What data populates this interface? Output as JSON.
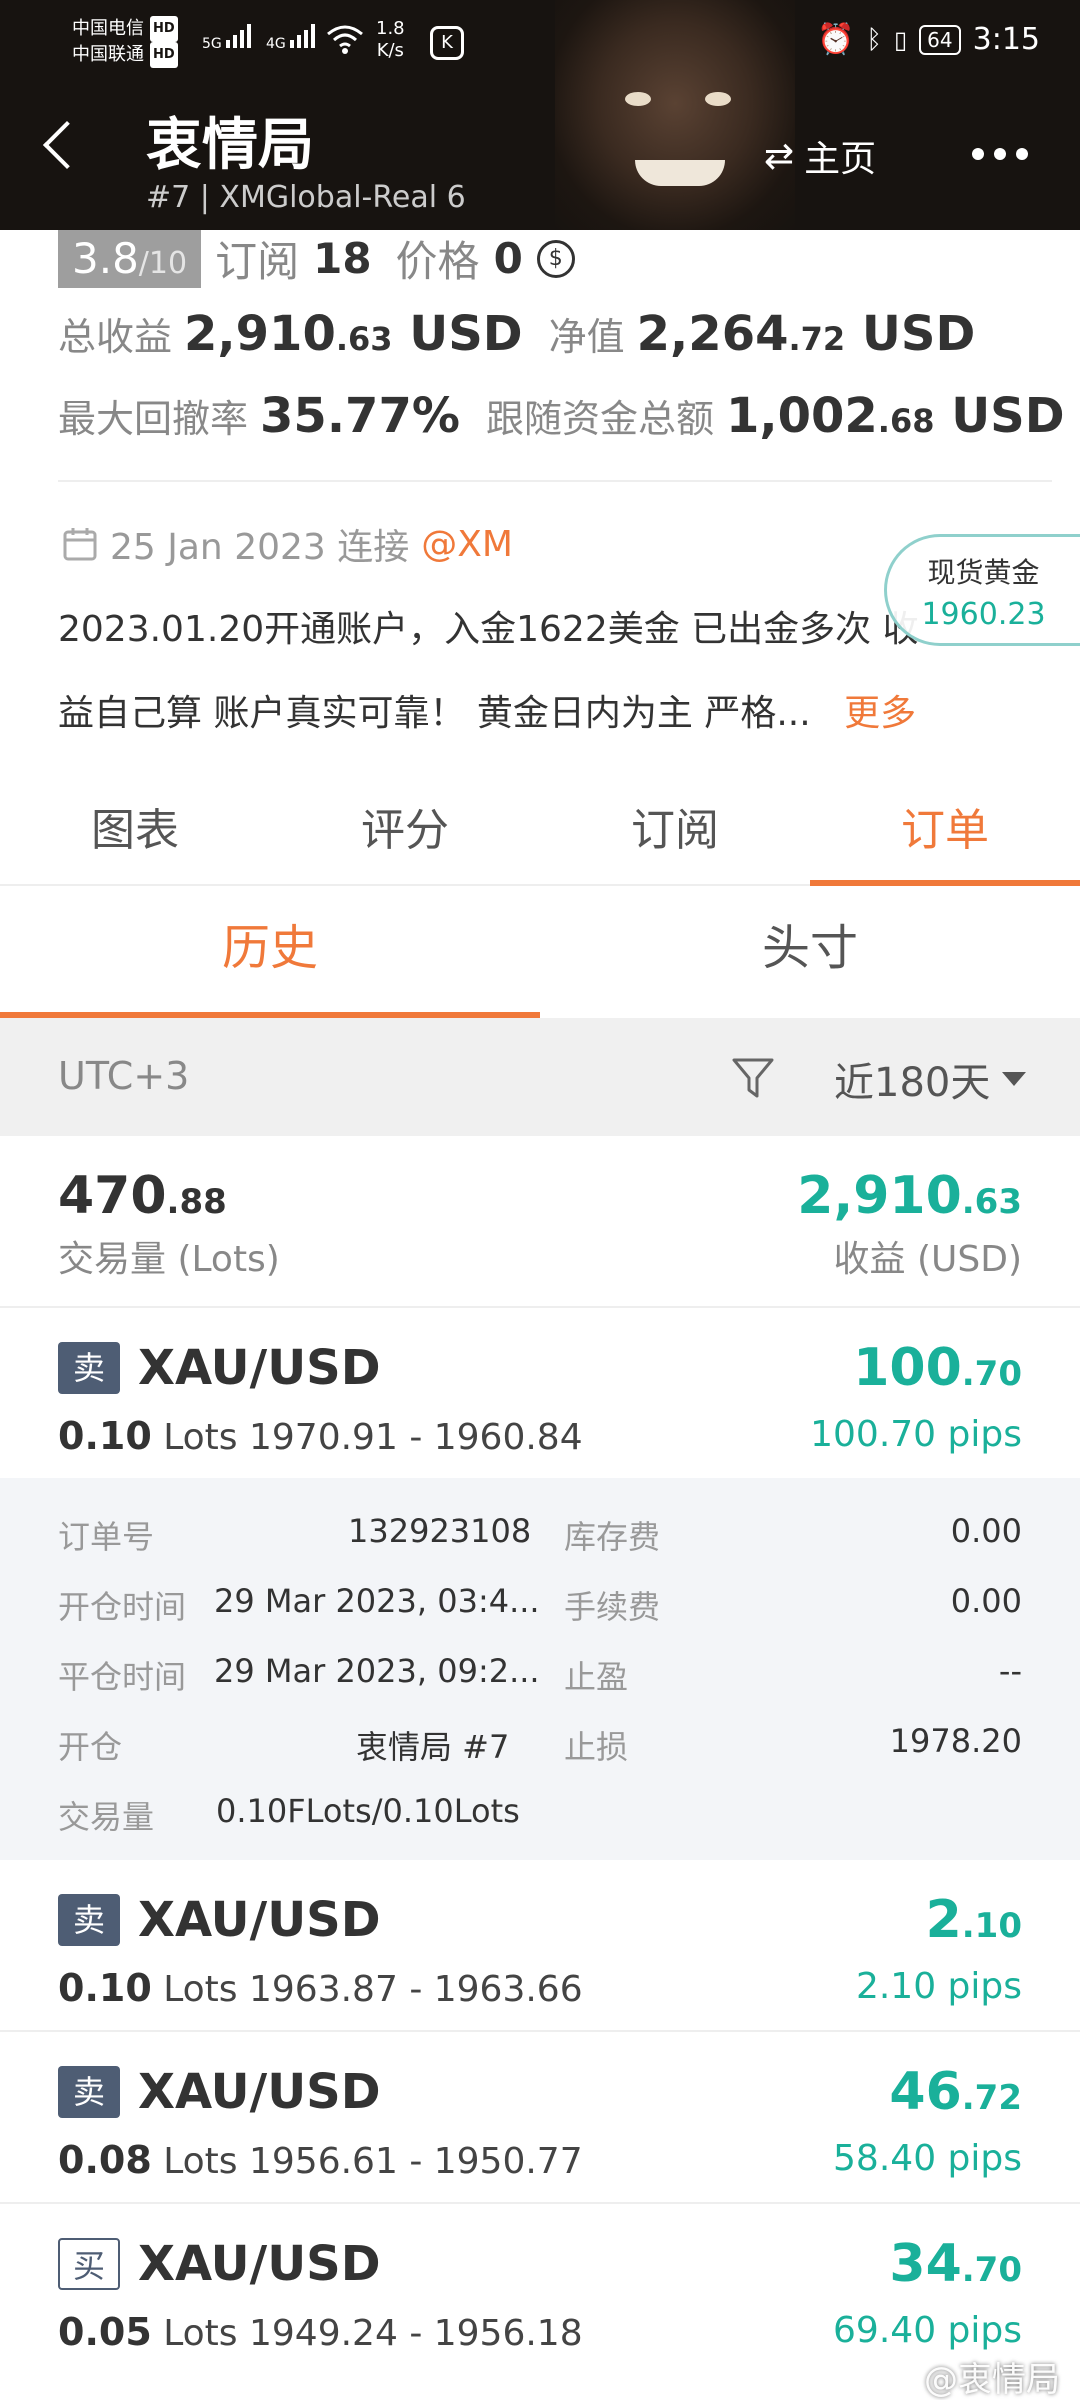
{
  "status_bar": {
    "carrier1": "中国电信",
    "carrier2": "中国联通",
    "hd": "HD",
    "net1": "5G",
    "net2": "4G",
    "speed_value": "1.8",
    "speed_unit": "K/s",
    "battery": "64",
    "time": "3:15"
  },
  "header": {
    "title": "衷情局",
    "subtitle": "#7 | XMGlobal-Real 6",
    "home_label": "主页"
  },
  "info": {
    "rating": "3.8",
    "rating_max": "/10",
    "subscribe_label": "订阅",
    "subscribe_count": "18",
    "price_label": "价格",
    "price_value": "0",
    "total_profit_label": "总收益",
    "total_profit_int": "2,910",
    "total_profit_dec": ".63",
    "total_profit_unit": "USD",
    "equity_label": "净值",
    "equity_int": "2,264",
    "equity_dec": ".72",
    "equity_unit": "USD",
    "max_drawdown_label": "最大回撤率",
    "max_drawdown_value": "35.77%",
    "follow_label": "跟随资金总额",
    "follow_int": "1,002",
    "follow_dec": ".68",
    "follow_unit": "USD",
    "date": "25 Jan 2023 连接",
    "broker": "@XM",
    "desc_line1": "2023.01.20开通账户，入金1622美金 已出金多次 收",
    "desc_line2": "益自己算 账户真实可靠！ 黄金日内为主 严格...",
    "more": "更多"
  },
  "gold_bubble": {
    "label": "现货黄金",
    "value": "1960.23"
  },
  "tabs": [
    "图表",
    "评分",
    "订阅",
    "订单"
  ],
  "active_tab": "订单",
  "subtabs": [
    "历史",
    "头寸"
  ],
  "filter": {
    "timezone": "UTC+3",
    "range": "近180天"
  },
  "summary": {
    "volume_int": "470",
    "volume_dec": ".88",
    "volume_label": "交易量 (Lots)",
    "profit_int": "2,910",
    "profit_dec": ".63",
    "profit_label": "收益 (USD)"
  },
  "orders": [
    {
      "side": "卖",
      "symbol": "XAU/USD",
      "lots": "0.10",
      "lots_unit": "Lots",
      "range": "1970.91 - 1960.84",
      "profit_int": "100",
      "profit_dec": ".70",
      "pips": "100.70 pips"
    },
    {
      "side": "卖",
      "symbol": "XAU/USD",
      "lots": "0.10",
      "lots_unit": "Lots",
      "range": "1963.87 - 1963.66",
      "profit_int": "2",
      "profit_dec": ".10",
      "pips": "2.10 pips"
    },
    {
      "side": "卖",
      "symbol": "XAU/USD",
      "lots": "0.08",
      "lots_unit": "Lots",
      "range": "1956.61 - 1950.77",
      "profit_int": "46",
      "profit_dec": ".72",
      "pips": "58.40 pips"
    },
    {
      "side": "买",
      "symbol": "XAU/USD",
      "lots": "0.05",
      "lots_unit": "Lots",
      "range": "1949.24 - 1956.18",
      "profit_int": "34",
      "profit_dec": ".70",
      "pips": "69.40 pips"
    }
  ],
  "detail": {
    "order_no_label": "订单号",
    "order_no": "132923108",
    "swap_label": "库存费",
    "swap": "0.00",
    "open_time_label": "开仓时间",
    "open_time": "29 Mar 2023, 03:4...",
    "fee_label": "手续费",
    "fee": "0.00",
    "close_time_label": "平仓时间",
    "close_time": "29 Mar 2023, 09:2...",
    "tp_label": "止盈",
    "tp": "--",
    "open_label": "开仓",
    "open_by": "衷情局 #7",
    "sl_label": "止损",
    "sl": "1978.20",
    "volume_label": "交易量",
    "volume": "0.10FLots/0.10Lots"
  },
  "watermark": "@衷情局"
}
